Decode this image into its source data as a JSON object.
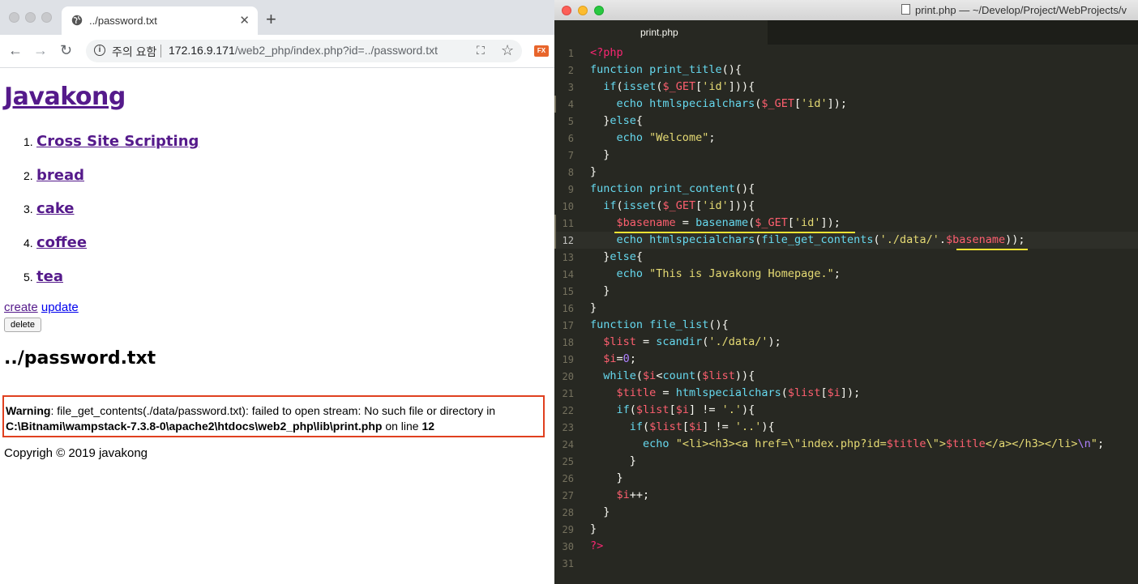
{
  "browser": {
    "tab_title": "../password.txt",
    "address": {
      "security_label": "주의 요함",
      "host": "172.16.9.171",
      "path": "/web2_php/index.php?id=../password.txt"
    },
    "page": {
      "site_title": "Javakong",
      "nav_items": [
        {
          "num": "1.",
          "label": "Cross Site Scripting"
        },
        {
          "num": "2.",
          "label": "bread"
        },
        {
          "num": "3.",
          "label": "cake"
        },
        {
          "num": "4.",
          "label": "coffee"
        },
        {
          "num": "5.",
          "label": "tea"
        }
      ],
      "create_label": "create",
      "update_label": "update",
      "delete_label": "delete",
      "heading": "../password.txt",
      "warning": {
        "label": "Warning",
        "message": ": file_get_contents(./data/password.txt): failed to open stream: No such file or directory in",
        "file": "C:\\Bitnami\\wampstack-7.3.8-0\\apache2\\htdocs\\web2_php\\lib\\print.php",
        "on_line": " on line ",
        "line_no": "12"
      },
      "footer": "Copyrigh © 2019 javakong"
    }
  },
  "editor": {
    "window_title": "print.php — ~/Develop/Project/WebProjects/v",
    "tab_label": "print.php",
    "line_numbers": [
      "1",
      "2",
      "3",
      "4",
      "5",
      "6",
      "7",
      "8",
      "9",
      "10",
      "11",
      "12",
      "13",
      "14",
      "15",
      "16",
      "17",
      "18",
      "19",
      "20",
      "21",
      "22",
      "23",
      "24",
      "25",
      "26",
      "27",
      "28",
      "29",
      "30",
      "31"
    ],
    "highlighted_line": "12",
    "colors": {
      "background": "#272822",
      "keyword": "#66d9ef",
      "variable": "#fd5f6f",
      "string": "#e6db74",
      "tag": "#f92672",
      "underline": "#f2e233"
    }
  }
}
